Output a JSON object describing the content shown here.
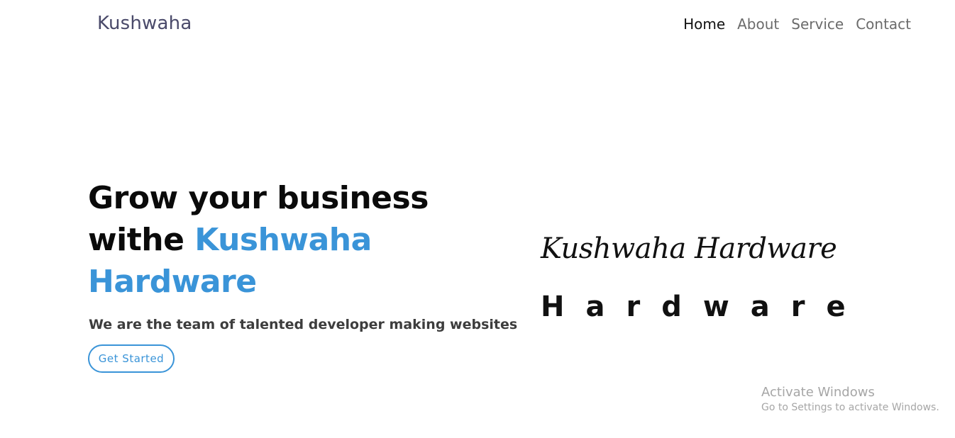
{
  "nav": {
    "brand": "Kushwaha",
    "links": [
      "Home",
      "About",
      "Service",
      "Contact"
    ],
    "active": "Home"
  },
  "hero": {
    "title_line1": "Grow your business",
    "title_withe": "withe",
    "title_accent_1": "Kushwaha",
    "title_accent_2": "Hardware",
    "subtitle": "We are the team of talented developer making websites",
    "cta": "Get Started"
  },
  "logo_image": {
    "script_text": "Kushwaha Hardware",
    "wide_text": "Hardware"
  },
  "watermark": {
    "title": "Activate Windows",
    "subtitle": "Go to Settings to activate Windows."
  },
  "colors": {
    "accent": "#3a94d8",
    "brand": "#4a4a6a",
    "nav_inactive": "#6b6b6b",
    "nav_active": "#111111"
  }
}
